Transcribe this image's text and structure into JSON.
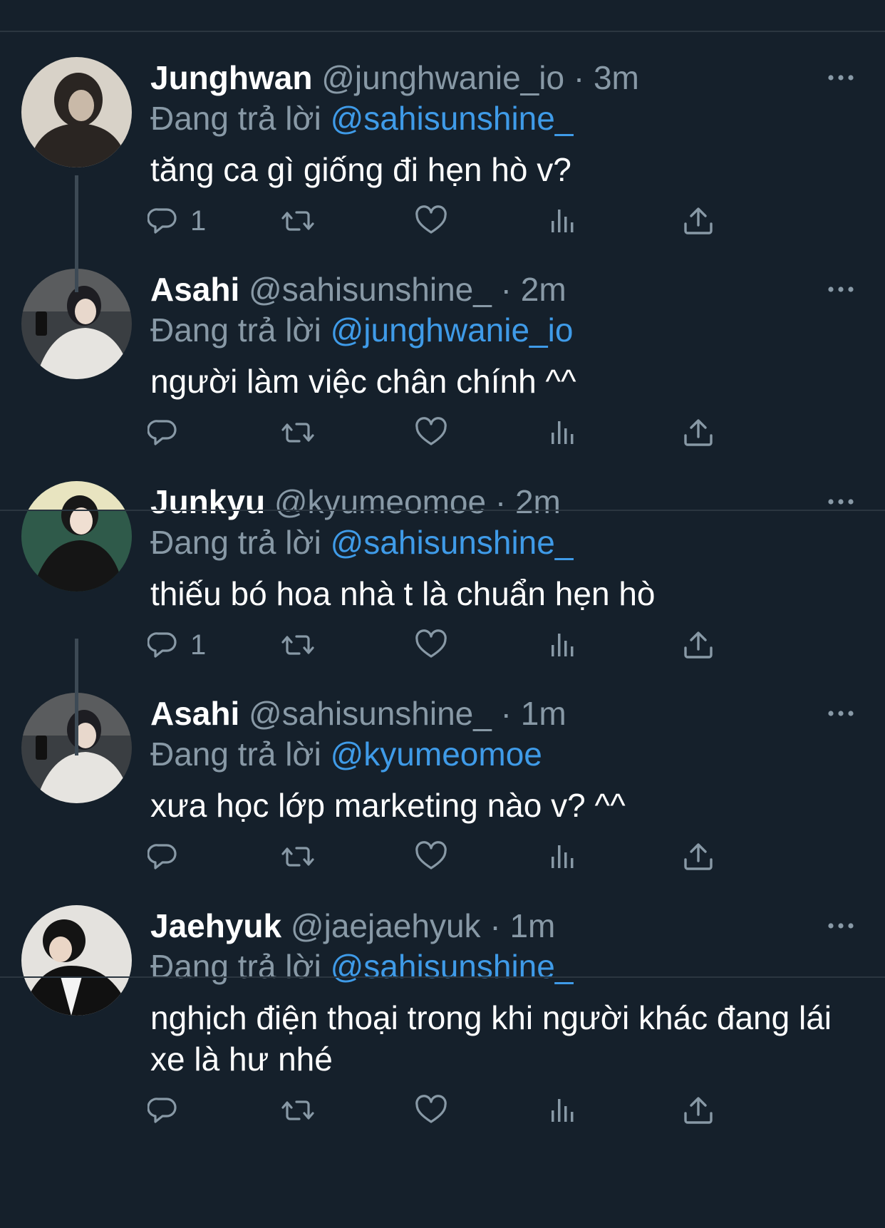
{
  "tweets": [
    {
      "name": "Junghwan",
      "handle": "@junghwanie_io",
      "dot": "·",
      "time": "3m",
      "reply_prefix": "Đang trả lời",
      "reply_to": "@sahisunshine_",
      "text": "tăng ca gì giống đi hẹn hò v?",
      "reply_count": "1",
      "avatar_color": "#2a2522"
    },
    {
      "name": "Asahi",
      "handle": "@sahisunshine_",
      "dot": "·",
      "time": "2m",
      "reply_prefix": "Đang trả lời",
      "reply_to": "@junghwanie_io",
      "text": "người làm việc chân chính ^^",
      "reply_count": "",
      "avatar_color": "#8e8a84"
    },
    {
      "name": "Junkyu",
      "handle": "@kyumeomoe",
      "dot": "·",
      "time": "2m",
      "reply_prefix": "Đang trả lời",
      "reply_to": "@sahisunshine_",
      "text": "thiếu bó hoa nhà t là chuẩn hẹn hò",
      "reply_count": "1",
      "avatar_color": "#2d3a34"
    },
    {
      "name": "Asahi",
      "handle": "@sahisunshine_",
      "dot": "·",
      "time": "1m",
      "reply_prefix": "Đang trả lời",
      "reply_to": "@kyumeomoe",
      "text": "xưa học lớp marketing nào v? ^^",
      "reply_count": "",
      "avatar_color": "#8e8a84"
    },
    {
      "name": "Jaehyuk",
      "handle": "@jaejaehyuk",
      "dot": "·",
      "time": "1m",
      "reply_prefix": "Đang trả lời",
      "reply_to": "@sahisunshine_",
      "text": "nghịch điện thoại trong khi người khác đang lái xe là hư nhé",
      "reply_count": "",
      "avatar_color": "#d9d6d2"
    }
  ],
  "icons": [
    "reply-icon",
    "retweet-icon",
    "like-icon",
    "views-icon",
    "share-icon",
    "more-icon"
  ],
  "colors": {
    "background": "#15202b",
    "muted": "#8899a6",
    "mention": "#3f9be8",
    "divider": "#2b3640"
  }
}
